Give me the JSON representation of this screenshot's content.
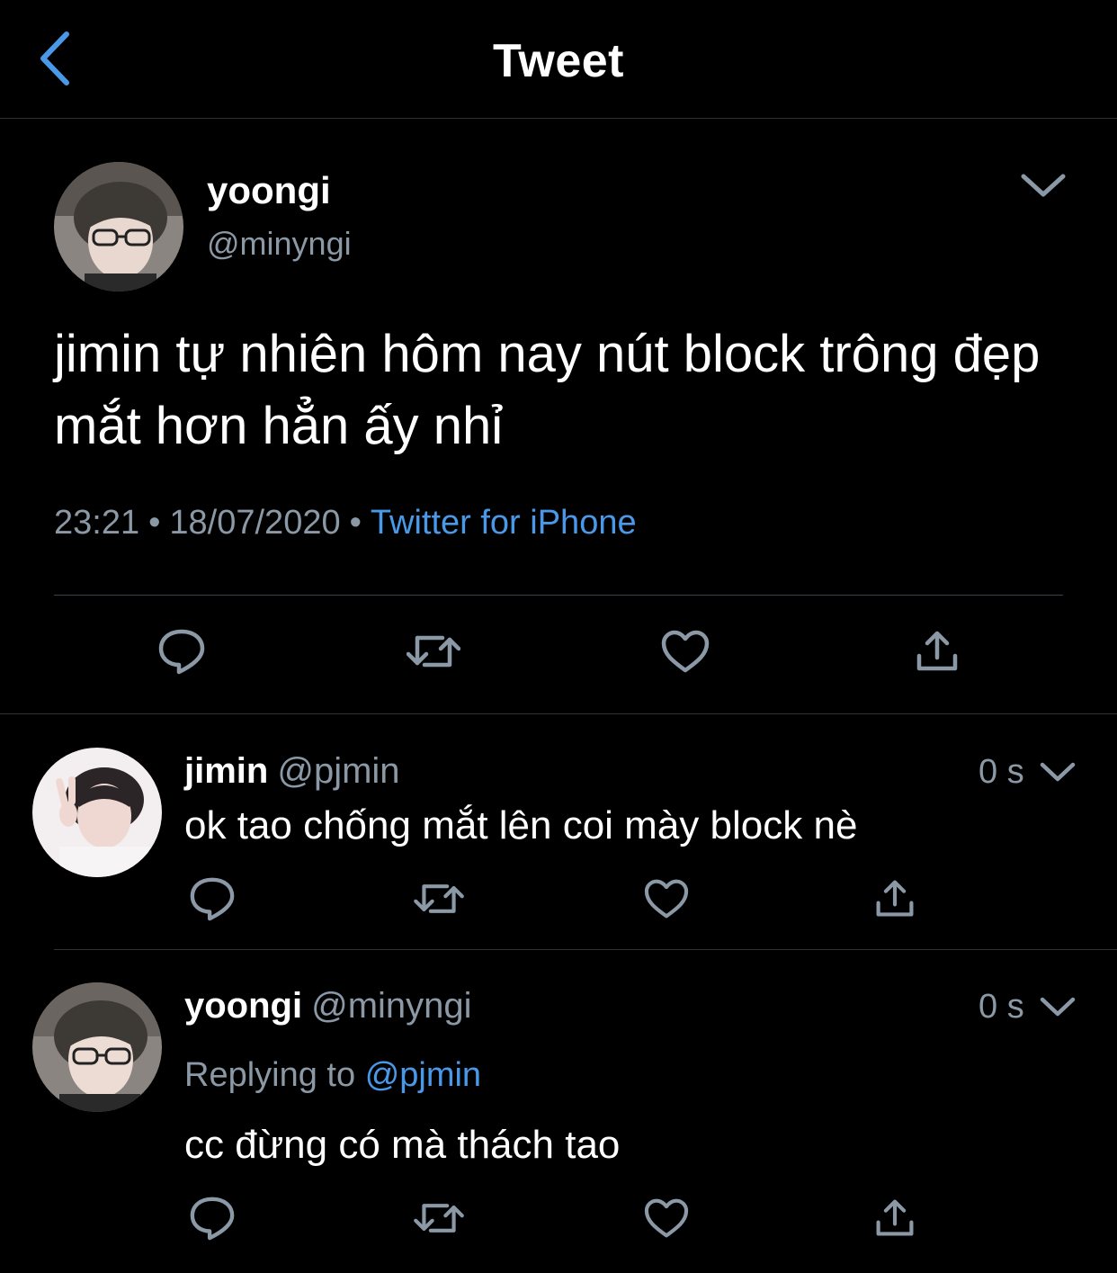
{
  "navbar": {
    "title": "Tweet",
    "back_icon": "chevron-left-icon"
  },
  "colors": {
    "background": "#000000",
    "accent": "#4a99e9",
    "secondary_text": "#8b98a5",
    "divider": "#2f3336"
  },
  "tweet": {
    "author_name": "yoongi",
    "author_handle": "@minyngi",
    "text": "jimin tự nhiên hôm nay nút block trông đẹp mắt hơn hẳn ấy nhỉ",
    "time": "23:21",
    "date": "18/07/2020",
    "separator": "•",
    "source": "Twitter for iPhone",
    "actions": [
      "reply-icon",
      "retweet-icon",
      "like-icon",
      "share-icon"
    ]
  },
  "replies": [
    {
      "author_name": "jimin",
      "author_handle": "@pjmin",
      "time": "0 s",
      "text": "ok tao chống mắt lên coi mày block nè"
    },
    {
      "author_name": "yoongi",
      "author_handle": "@minyngi",
      "time": "0 s",
      "replying_prefix": "Replying to",
      "replying_to": "@pjmin",
      "text": "cc đừng có mà thách tao"
    }
  ]
}
